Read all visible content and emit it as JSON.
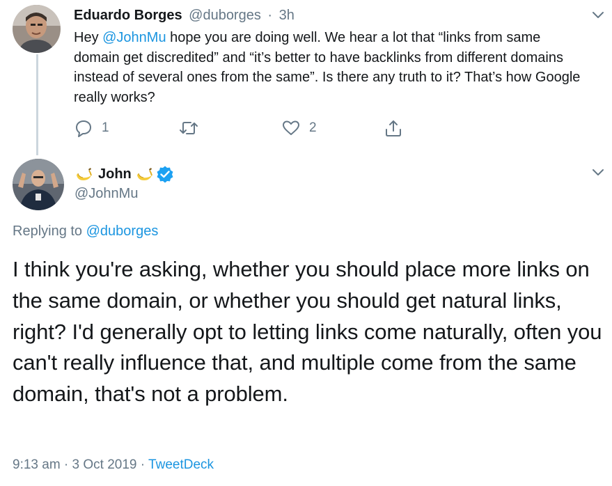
{
  "tweet1": {
    "author_name": "Eduardo Borges",
    "author_handle": "@duborges",
    "separator": "·",
    "time": "3h",
    "text_prefix": "Hey ",
    "mention": "@JohnMu",
    "text_suffix": " hope you are doing well. We hear a lot that “links from same domain get discredited” and “it’s better to have backlinks from different domains instead of several ones from the same”. Is there any truth to it? That’s how Google really works?",
    "reply_count": "1",
    "retweet_count": "",
    "like_count": "2"
  },
  "tweet2": {
    "author_name": "John",
    "author_handle": "@JohnMu",
    "verified": true,
    "replying_prefix": "Replying to ",
    "replying_to": "@duborges",
    "text": "I think you're asking, whether you should place more links on the same domain, or whether you should get natural links, right? I'd generally opt to letting links come naturally, often you can't really influence that, and multiple come from the same domain, that's not a problem.",
    "time": "9:13 am",
    "date_separator": " · ",
    "date": "3 Oct 2019",
    "source_separator": " · ",
    "source": "TweetDeck"
  },
  "icons": {
    "reply": "reply-icon",
    "retweet": "retweet-icon",
    "like": "heart-icon",
    "share": "share-icon",
    "more": "chevron-down-icon",
    "verified": "verified-badge-icon",
    "emoji": "banana-emoji"
  },
  "colors": {
    "text": "#14171a",
    "muted": "#657786",
    "link": "#1b95e0",
    "verified": "#1da1f2",
    "thread_line": "#ccd6dd"
  }
}
